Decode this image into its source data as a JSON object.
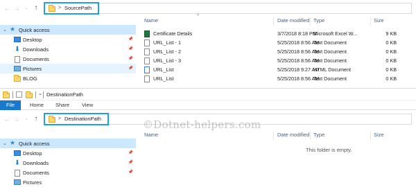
{
  "top_window": {
    "address": {
      "path": "SourcePath",
      "chevron": ">"
    },
    "nav": {
      "quick_access": "Quick access",
      "items": [
        {
          "label": "Desktop",
          "icon": "desktop-icon"
        },
        {
          "label": "Downloads",
          "icon": "downloads-icon"
        },
        {
          "label": "Documents",
          "icon": "documents-icon"
        },
        {
          "label": "Pictures",
          "icon": "pictures-icon"
        },
        {
          "label": "BLOG",
          "icon": "folder-icon"
        }
      ]
    },
    "columns": {
      "name": "Name",
      "date": "Date modified",
      "type": "Type",
      "size": "Size"
    },
    "files": [
      {
        "name": "Certificate Details",
        "date": "3/7/2018 8:18 PM",
        "type": "Microsoft Excel W...",
        "size": "9 KB",
        "icon": "excel-file-icon"
      },
      {
        "name": "URL_List - 1",
        "date": "5/25/2018 8:56 AM",
        "type": "Text Document",
        "size": "0 KB",
        "icon": "text-file-icon"
      },
      {
        "name": "URL_List - 2",
        "date": "5/25/2018 8:56 AM",
        "type": "Text Document",
        "size": "0 KB",
        "icon": "text-file-icon"
      },
      {
        "name": "URL_List - 3",
        "date": "5/25/2018 8:56 AM",
        "type": "Text Document",
        "size": "0 KB",
        "icon": "text-file-icon"
      },
      {
        "name": "URL_List",
        "date": "5/25/2018 9:27 AM",
        "type": "HTML Document",
        "size": "0 KB",
        "icon": "html-file-icon"
      },
      {
        "name": "URL_List",
        "date": "5/25/2018 8:56 AM",
        "type": "Text Document",
        "size": "0 KB",
        "icon": "text-file-icon"
      }
    ]
  },
  "bottom_window": {
    "title": "DestinationPath",
    "ribbon_tabs": {
      "file": "File",
      "home": "Home",
      "share": "Share",
      "view": "View"
    },
    "address": {
      "path": "DestinationPath",
      "chevron": ">"
    },
    "nav": {
      "quick_access": "Quick access",
      "items": [
        {
          "label": "Desktop",
          "icon": "desktop-icon"
        },
        {
          "label": "Downloads",
          "icon": "downloads-icon"
        },
        {
          "label": "Documents",
          "icon": "documents-icon"
        },
        {
          "label": "Pictures",
          "icon": "pictures-icon"
        }
      ]
    },
    "columns": {
      "name": "Name",
      "date": "Date modified",
      "type": "Type",
      "size": "Size"
    },
    "empty_message": "This folder is empty.",
    "watermark": "©Dotnet-helpers.com"
  },
  "colors": {
    "highlight": "#1ea0e1",
    "selection": "#cce8ff",
    "file_tab": "#1979ca"
  }
}
